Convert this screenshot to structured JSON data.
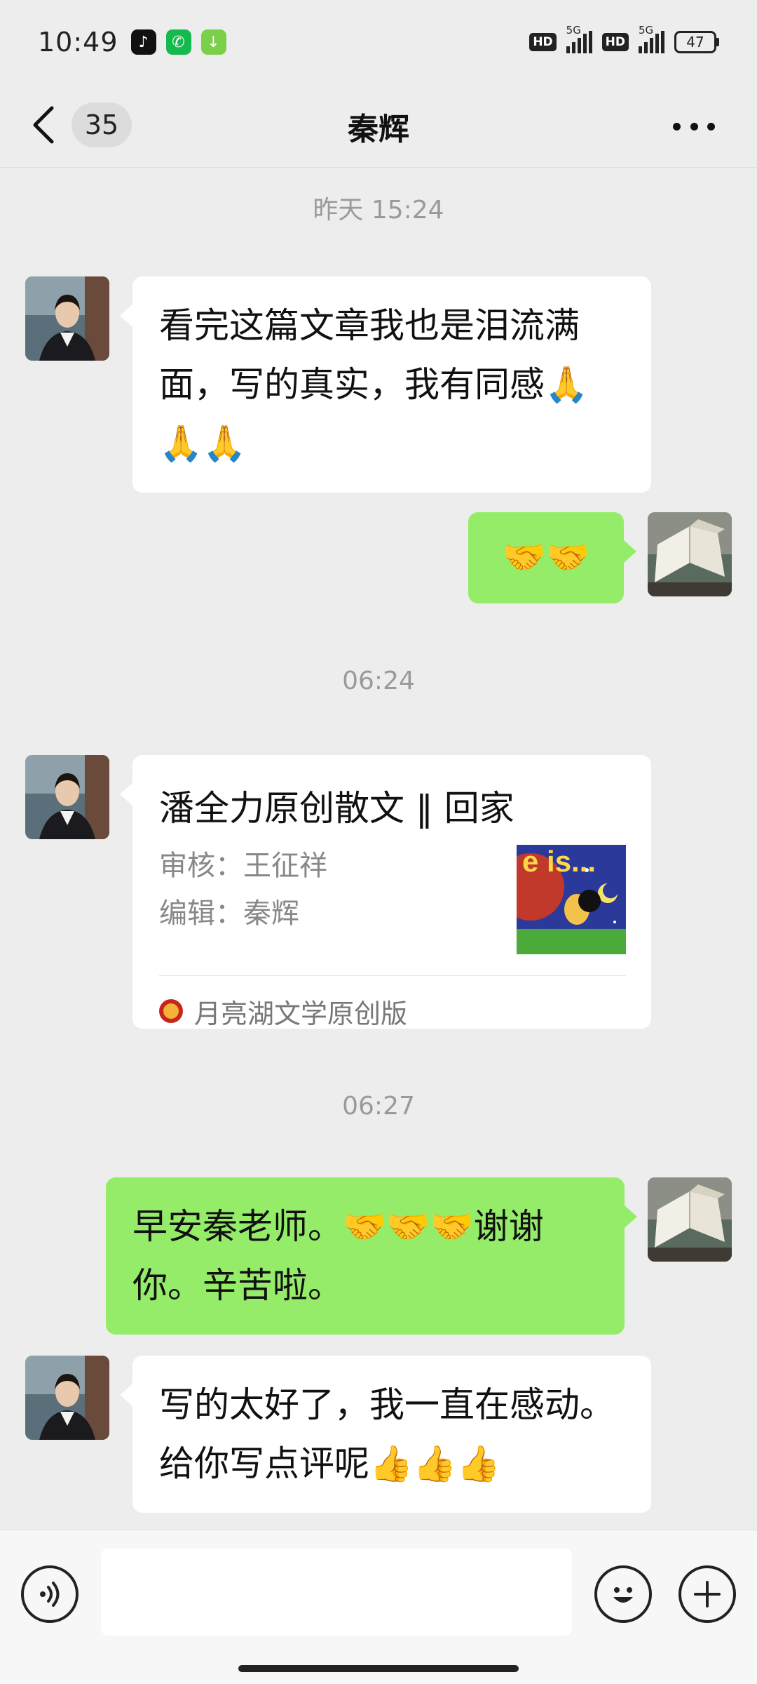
{
  "status_bar": {
    "time": "10:49",
    "network_1": "5G",
    "network_2": "5G",
    "hd_1": "HD",
    "hd_2": "HD",
    "battery": "47"
  },
  "nav": {
    "unread_count": "35",
    "title": "秦辉"
  },
  "messages": {
    "time_1": "昨天 15:24",
    "msg_1": "看完这篇文章我也是泪流满面，写的真实，我有同感🙏🙏🙏",
    "msg_2": "🤝🤝",
    "time_2": "06:24",
    "card": {
      "title": "潘全力原创散文 ‖ 回家",
      "reviewer": "审核：王征祥",
      "editor": "编辑：秦辉",
      "source": "月亮湖文学原创版"
    },
    "time_3": "06:27",
    "msg_3": "早安秦老师。🤝🤝🤝谢谢你。辛苦啦。",
    "msg_4": "写的太好了，我一直在感动。给你写点评呢👍👍👍"
  },
  "input": {
    "value": ""
  },
  "colors": {
    "background": "#ededed",
    "bubble_out": "#95ec69",
    "bubble_in": "#ffffff"
  }
}
